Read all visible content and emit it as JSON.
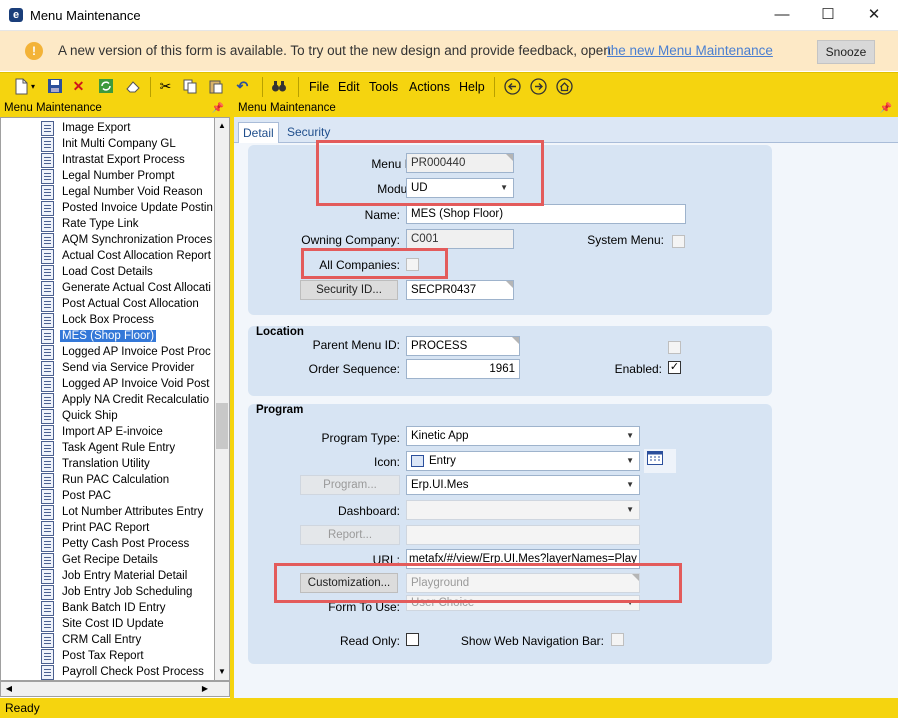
{
  "window": {
    "title": "Menu Maintenance",
    "app_icon": "e",
    "minimize": "—",
    "maximize": "☐",
    "close": "✕"
  },
  "notification": {
    "text": "A new version of this form is available. To try out the new design and provide feedback, open",
    "link": "the new Menu Maintenance",
    "snooze": "Snooze"
  },
  "toolbar": {
    "menus": [
      "File",
      "Edit",
      "Tools",
      "Actions",
      "Help"
    ]
  },
  "left_pane": {
    "header": "Menu Maintenance",
    "items": [
      "Image Export",
      "Init Multi Company GL",
      "Intrastat Export Process",
      "Legal Number Prompt",
      "Legal Number Void Reason",
      "Posted Invoice Update Postin",
      "Rate Type Link",
      "AQM Synchronization Proces",
      "Actual Cost Allocation Report",
      "Load Cost  Details",
      "Generate Actual Cost Allocati",
      "Post Actual Cost Allocation",
      "Lock Box Process",
      "MES (Shop Floor)",
      "Logged AP Invoice Post Proc",
      "Send via Service Provider",
      "Logged AP Invoice Void Post",
      "Apply NA Credit Recalculatio",
      "Quick Ship",
      "Import AP E-invoice",
      "Task Agent Rule Entry",
      "Translation Utility",
      "Run PAC Calculation",
      "Post PAC",
      "Lot Number Attributes Entry",
      "Print PAC Report",
      "Petty Cash Post Process",
      "Get Recipe Details",
      "Job Entry Material Detail",
      "Job Entry Job Scheduling",
      "Bank Batch ID Entry",
      "Site Cost ID Update",
      "CRM Call Entry",
      "Post Tax Report",
      "Payroll Check Post Process"
    ]
  },
  "right_pane": {
    "header": "Menu Maintenance",
    "tabs": [
      "Detail",
      "Security"
    ],
    "detail": {
      "menu_id_label": "Menu ID:",
      "menu_id": "PR000440",
      "module_label": "Module:",
      "module": "UD",
      "name_label": "Name:",
      "name": "MES (Shop Floor)",
      "owning_company_label": "Owning Company:",
      "owning_company": "C001",
      "system_menu_label": "System Menu:",
      "all_companies_label": "All Companies:",
      "security_id_button": "Security ID...",
      "security_id": "SECPR0437"
    },
    "location": {
      "title": "Location",
      "parent_menu_id_label": "Parent Menu ID:",
      "parent_menu_id": "PROCESS",
      "order_sequence_label": "Order Sequence:",
      "order_sequence": "1961",
      "enabled_label": "Enabled:",
      "enabled": true
    },
    "program": {
      "title": "Program",
      "program_type_label": "Program Type:",
      "program_type": "Kinetic App",
      "icon_label": "Icon:",
      "icon": "Entry",
      "program_button": "Program...",
      "program": "Erp.UI.Mes",
      "dashboard_label": "Dashboard:",
      "dashboard": "",
      "report_button": "Report...",
      "report": "",
      "url_label": "URL:",
      "url": "metafx/#/view/Erp.UI.Mes?layerNames=Play",
      "customization_button": "Customization...",
      "customization": "Playground",
      "form_to_use_label": "Form To Use:",
      "form_to_use": "User Choice",
      "read_only_label": "Read Only:",
      "show_web_nav_label": "Show Web Navigation Bar:"
    }
  },
  "status": {
    "text": "Ready"
  }
}
